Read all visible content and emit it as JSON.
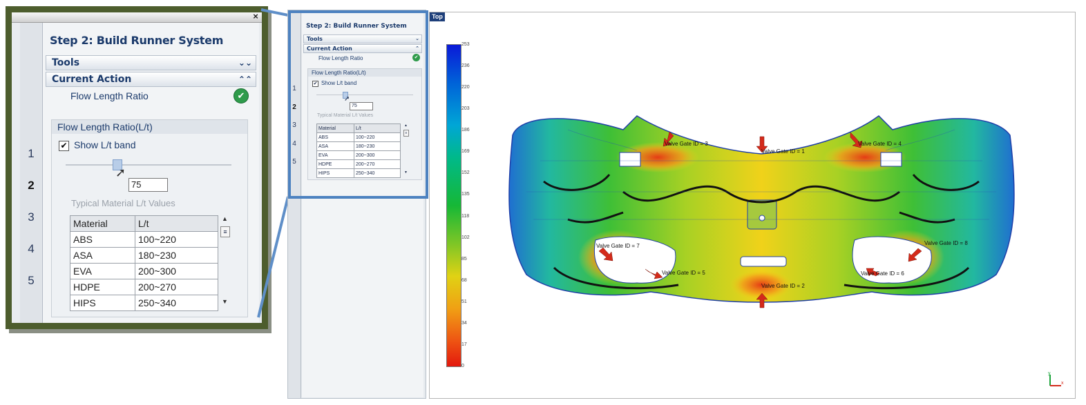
{
  "panel": {
    "step_title": "Step 2: Build Runner System",
    "tools_label": "Tools",
    "current_action_label": "Current Action",
    "flow_length_ratio": "Flow Length Ratio",
    "group_title": "Flow Length Ratio(L/t)",
    "show_band_label": "Show L/t band",
    "lt_value": "75",
    "typical_label": "Typical Material L/t Values",
    "tabs": [
      "1",
      "2",
      "3",
      "4",
      "5"
    ],
    "table": {
      "headers": [
        "Material",
        "L/t"
      ],
      "rows": [
        [
          "ABS",
          "100~220"
        ],
        [
          "ASA",
          "180~230"
        ],
        [
          "EVA",
          "200~300"
        ],
        [
          "HDPE",
          "200~270"
        ],
        [
          "HIPS",
          "250~340"
        ]
      ]
    }
  },
  "viewport": {
    "view_label": "Top",
    "scale_ticks": [
      "253",
      "236",
      "220",
      "203",
      "186",
      "169",
      "152",
      "135",
      "118",
      "102",
      "85",
      "68",
      "51",
      "34",
      "17",
      "0"
    ],
    "gates": [
      "Valve Gate ID = 3",
      "Valve Gate ID = 1",
      "Valve Gate ID = 4",
      "Valve Gate ID = 7",
      "Valve Gate ID = 5",
      "Valve Gate ID = 2",
      "Valve Gate ID = 6",
      "Valve Gate ID = 8"
    ],
    "axis_y": "y",
    "axis_x": "x"
  },
  "colors": {
    "zoom_border": "#4d5d2d",
    "panel_frame": "#4d82c0",
    "title_blue": "#1b3a6b",
    "ok_green": "#2f9b4b"
  }
}
